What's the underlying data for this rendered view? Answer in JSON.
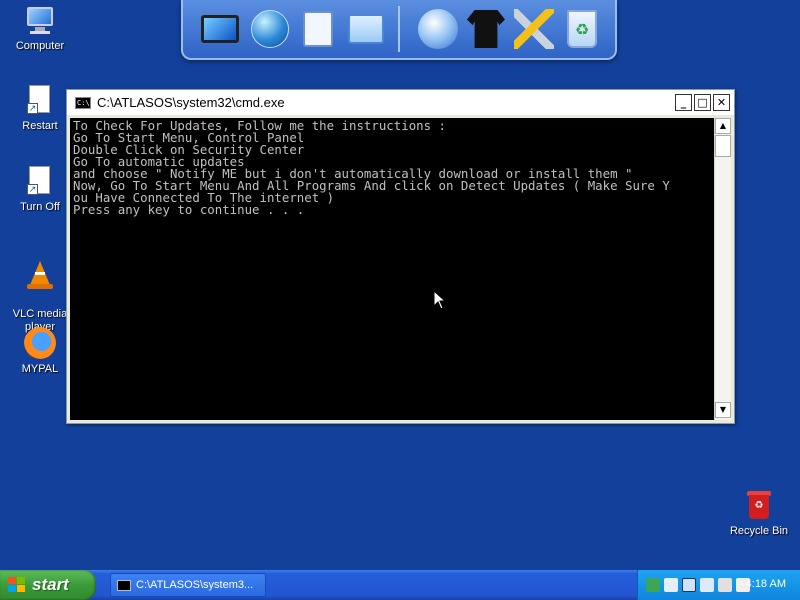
{
  "desktop": {
    "icons": [
      {
        "label": "Computer"
      },
      {
        "label": "Restart"
      },
      {
        "label": "Turn Off"
      },
      {
        "label": "VLC media\nplayer"
      },
      {
        "label": "MYPAL"
      },
      {
        "label": "Recycle Bin"
      }
    ]
  },
  "dock": {
    "items": [
      "monitor-icon",
      "globe-icon",
      "documents-icon",
      "control-panel-icon",
      "network-icon",
      "shirt-icon",
      "tools-icon",
      "recycle-icon"
    ]
  },
  "window": {
    "title": "C:\\ATLASOS\\system32\\cmd.exe",
    "icon_text": "C:\\",
    "buttons": {
      "minimize": "_",
      "maximize": "□",
      "close": "✕"
    },
    "console_lines": [
      "To Check For Updates, Follow me the instructions :",
      "Go To Start Menu, Control Panel",
      "Double Click on Security Center",
      "Go To automatic updates",
      "and choose \" Notify ME but i don't automatically download or install them \"",
      "Now, Go To Start Menu And All Programs And click on Detect Updates ( Make Sure Y",
      "ou Have Connected To The internet )",
      "Press any key to continue . . ."
    ],
    "scroll_up": "▲",
    "scroll_down": "▼"
  },
  "taskbar": {
    "start_label": "start",
    "task_button_label": "C:\\ATLASOS\\system3...",
    "clock": "4:18 AM"
  },
  "colors": {
    "desktop_bg": "#13409a",
    "console_bg": "#000000",
    "console_text": "#c0c0c0",
    "taskbar": "#245edb",
    "start_green": "#3b9c3a",
    "tray_blue": "#0f86dd"
  }
}
